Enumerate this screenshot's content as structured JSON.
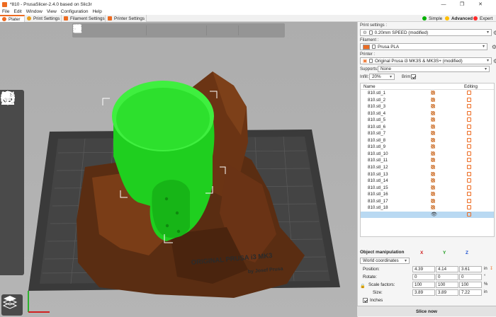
{
  "window": {
    "title": "*810 - PrusaSlicer-2.4.0 based on Slic3r",
    "controls": [
      "—",
      "❐",
      "✕"
    ]
  },
  "menu": [
    "File",
    "Edit",
    "Window",
    "View",
    "Configuration",
    "Help"
  ],
  "tabs": [
    {
      "label": "Plater",
      "icon_color": "#ed6b21",
      "active": true
    },
    {
      "label": "Print Settings",
      "icon_color": "#e8a020",
      "active": false
    },
    {
      "label": "Filament Settings",
      "icon_color": "#ed6b21",
      "active": false
    },
    {
      "label": "Printer Settings",
      "icon_color": "#ed6b21",
      "active": false
    }
  ],
  "modes": [
    {
      "label": "Simple",
      "color": "#00b000"
    },
    {
      "label": "Advanced",
      "color": "#ffbe00",
      "active": true
    },
    {
      "label": "Expert",
      "color": "#ff2a2a"
    }
  ],
  "viewport": {
    "bed_text_1": "ORIGINAL PRUSA i3 MK3",
    "bed_text_2": "by Josef Prusa",
    "toolbar_icons": [
      "add-icon",
      "delete-icon",
      "delete-all-icon",
      "arrange-icon",
      "copy-icon",
      "paste-icon",
      "add-instance-icon",
      "remove-instance-icon",
      "split-objects-icon",
      "split-parts-icon",
      "layer-editing-icon",
      "search-icon",
      "layers-icon",
      "undo-icon",
      "redo-icon"
    ],
    "gizmo_icons": [
      "move-icon",
      "scale-icon",
      "rotate-icon",
      "place-on-face-icon",
      "cut-icon",
      "support-painting-icon",
      "hollow-icon"
    ]
  },
  "panel": {
    "print_settings_label": "Print settings :",
    "print_settings_value": "0.20mm SPEED (modified)",
    "filament_label": "Filament :",
    "filament_value": "Prusa PLA",
    "filament_color": "#ed6b21",
    "printer_label": "Printer :",
    "printer_value": "Original Prusa i3 MK3S & MK3S+ (modified)",
    "supports_label": "Supports:",
    "supports_value": "None",
    "infill_label": "Infill:",
    "infill_value": "20%",
    "brim_label": "Brim:",
    "brim_checked": true
  },
  "objects": {
    "header_name": "Name",
    "header_editing": "Editing",
    "items": [
      "810.stl_1",
      "810.stl_2",
      "810.stl_3",
      "810.stl_4",
      "810.stl_5",
      "810.stl_6",
      "810.stl_7",
      "810.stl_8",
      "810.stl_9",
      "810.stl_10",
      "810.stl_11",
      "810.stl_12",
      "810.stl_13",
      "810.stl_14",
      "810.stl_15",
      "810.stl_16",
      "810.stl_17",
      "810.stl_18"
    ],
    "selected_item": ""
  },
  "manipulation": {
    "title": "Object manipulation",
    "coord_system": "World coordinates",
    "axis_x": "X",
    "axis_y": "Y",
    "axis_z": "Z",
    "position_label": "Position:",
    "position": [
      "4.39",
      "4.14",
      "3.61"
    ],
    "position_unit": "in",
    "rotate_label": "Rotate:",
    "rotate": [
      "0",
      "0",
      "0"
    ],
    "rotate_unit": "°",
    "scale_label": "Scale factors:",
    "scale": [
      "100",
      "100",
      "100"
    ],
    "scale_unit": "%",
    "size_label": "Size:",
    "size": [
      "3.89",
      "3.89",
      "7.22"
    ],
    "size_unit": "in",
    "inches_label": "Inches",
    "inches_checked": true
  },
  "slice_button": "Slice now"
}
